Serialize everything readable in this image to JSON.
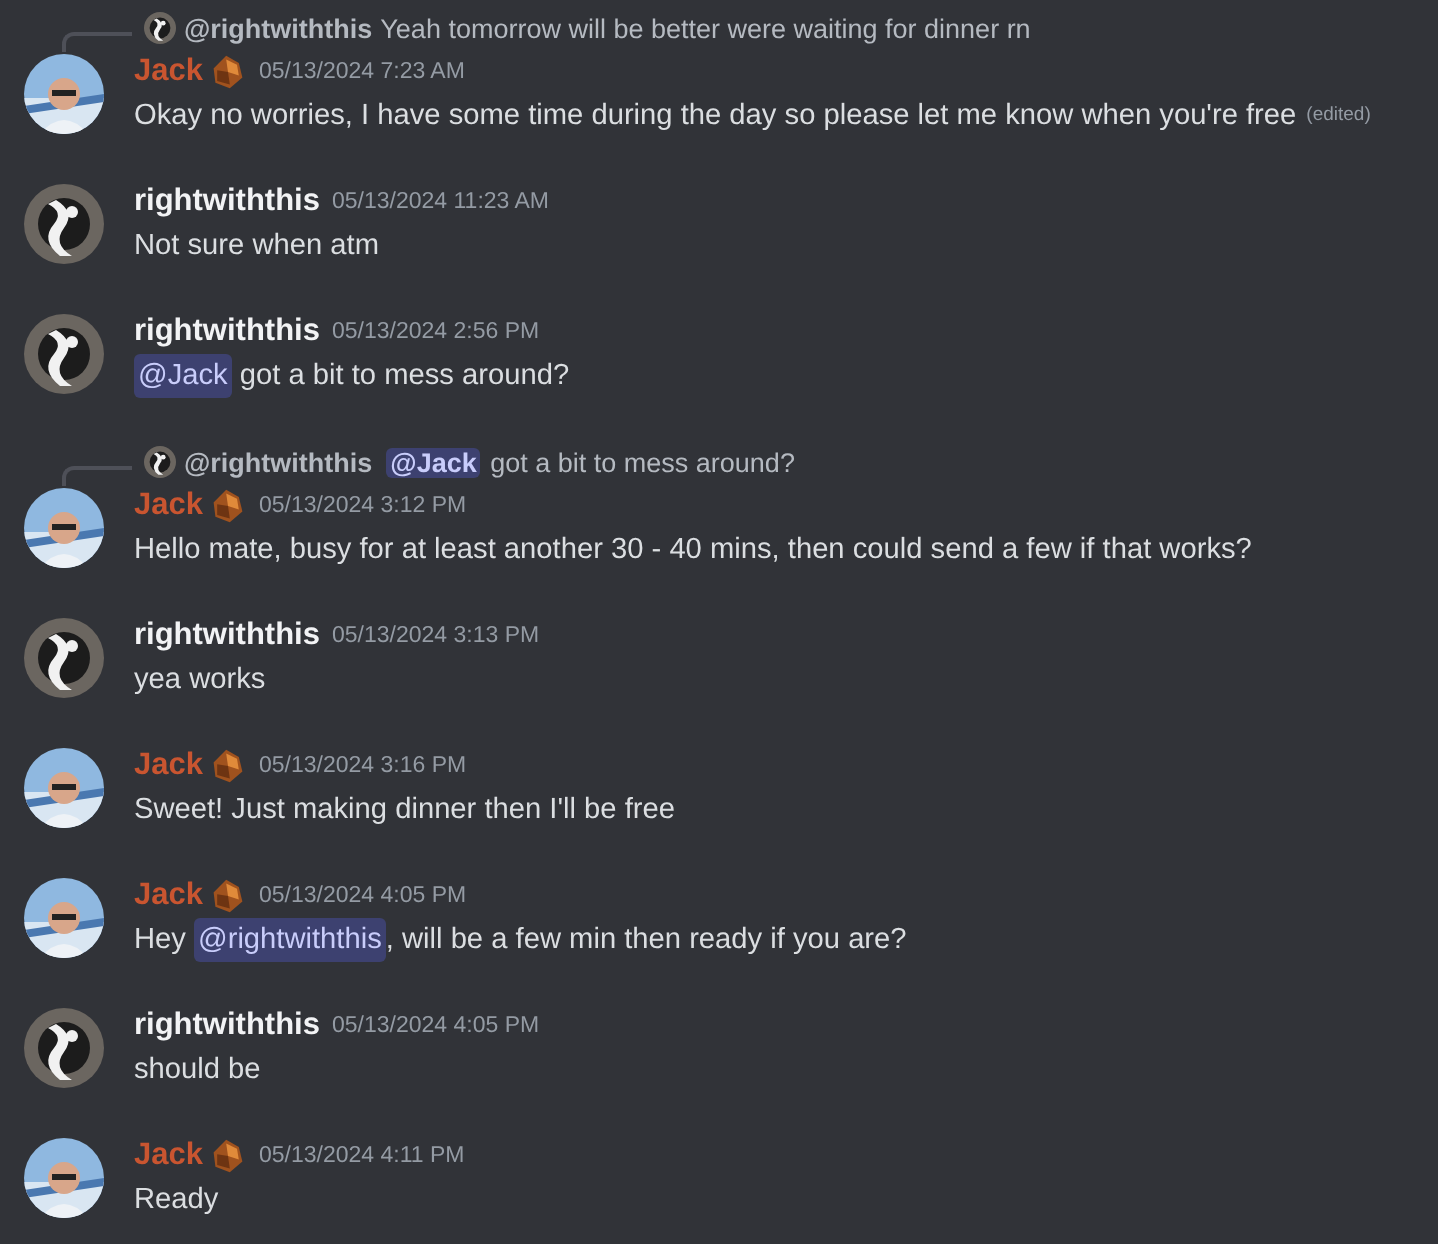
{
  "messages": [
    {
      "reply": {
        "author": "@rightwiththis",
        "parts": [
          {
            "kind": "plain",
            "text": "Yeah tomorrow will be better were waiting for dinner rn"
          }
        ]
      },
      "author": "Jack",
      "color": "#c95530",
      "role_icon": true,
      "timestamp": "05/13/2024 7:23 AM",
      "parts": [
        {
          "kind": "plain",
          "text": "Okay no worries, I have some time during the day so please let me know when you're free"
        }
      ],
      "edited": "(edited)"
    },
    {
      "author": "rightwiththis",
      "color": "#f2f3f5",
      "role_icon": false,
      "timestamp": "05/13/2024 11:23 AM",
      "parts": [
        {
          "kind": "plain",
          "text": "Not sure when atm"
        }
      ]
    },
    {
      "author": "rightwiththis",
      "color": "#f2f3f5",
      "role_icon": false,
      "timestamp": "05/13/2024 2:56 PM",
      "parts": [
        {
          "kind": "mention",
          "text": "@Jack"
        },
        {
          "kind": "plain",
          "text": " got a bit to mess around?"
        }
      ]
    },
    {
      "reply": {
        "author": "@rightwiththis",
        "parts": [
          {
            "kind": "mention",
            "text": "@Jack"
          },
          {
            "kind": "plain",
            "text": " got a bit to mess around?"
          }
        ]
      },
      "author": "Jack",
      "color": "#c95530",
      "role_icon": true,
      "timestamp": "05/13/2024 3:12 PM",
      "parts": [
        {
          "kind": "plain",
          "text": "Hello mate, busy for at least another 30 - 40 mins, then could send a few if that works?"
        }
      ]
    },
    {
      "author": "rightwiththis",
      "color": "#f2f3f5",
      "role_icon": false,
      "timestamp": "05/13/2024 3:13 PM",
      "parts": [
        {
          "kind": "plain",
          "text": "yea works"
        }
      ]
    },
    {
      "author": "Jack",
      "color": "#c95530",
      "role_icon": true,
      "timestamp": "05/13/2024 3:16 PM",
      "parts": [
        {
          "kind": "plain",
          "text": "Sweet! Just making dinner then I'll be free"
        }
      ]
    },
    {
      "author": "Jack",
      "color": "#c95530",
      "role_icon": true,
      "timestamp": "05/13/2024 4:05 PM",
      "parts": [
        {
          "kind": "plain",
          "text": "Hey "
        },
        {
          "kind": "mention",
          "text": "@rightwiththis"
        },
        {
          "kind": "plain",
          "text": ", will be a few min then ready if you are?"
        }
      ]
    },
    {
      "author": "rightwiththis",
      "color": "#f2f3f5",
      "role_icon": false,
      "timestamp": "05/13/2024 4:05 PM",
      "parts": [
        {
          "kind": "plain",
          "text": "should be"
        }
      ]
    },
    {
      "author": "Jack",
      "color": "#c95530",
      "role_icon": true,
      "timestamp": "05/13/2024 4:11 PM",
      "parts": [
        {
          "kind": "plain",
          "text": "Ready"
        }
      ]
    }
  ]
}
